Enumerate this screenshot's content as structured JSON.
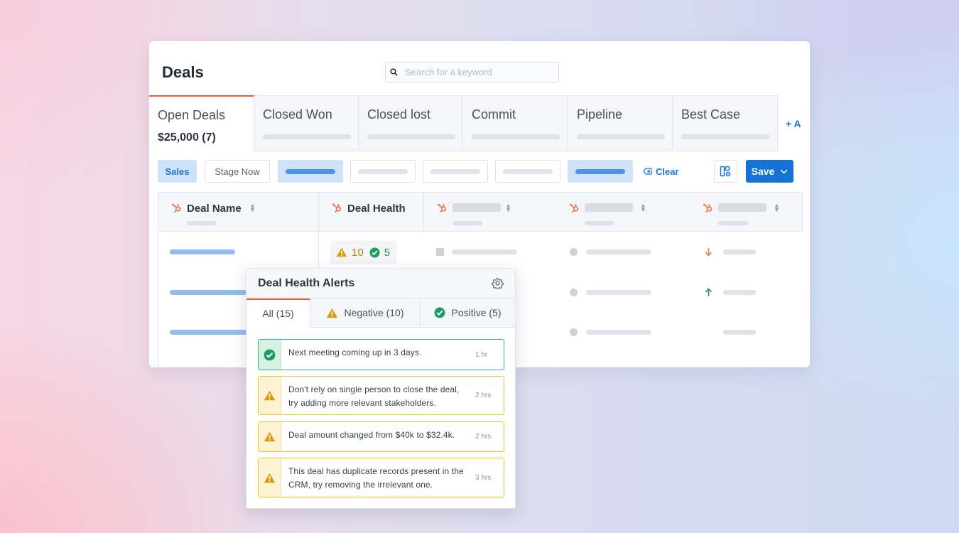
{
  "header": {
    "title": "Deals",
    "search_placeholder": "Search for a keyword"
  },
  "tabs": [
    {
      "label": "Open Deals",
      "value": "$25,000 (7)",
      "active": true
    },
    {
      "label": "Closed Won"
    },
    {
      "label": "Closed lost"
    },
    {
      "label": "Commit"
    },
    {
      "label": "Pipeline"
    },
    {
      "label": "Best Case"
    }
  ],
  "add_tab_label": "+ A",
  "filters": {
    "sales_label": "Sales",
    "stage_label": "Stage Now",
    "clear_label": "Clear",
    "save_label": "Save"
  },
  "table": {
    "columns": [
      "Deal Name",
      "Deal Health"
    ],
    "health": {
      "negative": "10",
      "positive": "5"
    }
  },
  "alerts_popover": {
    "title": "Deal Health Alerts",
    "tabs": [
      {
        "label": "All (15)",
        "icon": "none"
      },
      {
        "label": "Negative (10)",
        "icon": "warning-icon"
      },
      {
        "label": "Positive (5)",
        "icon": "check-circle-icon"
      }
    ],
    "alerts": [
      {
        "type": "positive",
        "text": "Next meeting coming up in 3 days.",
        "time": "1 hr"
      },
      {
        "type": "negative",
        "text": "Don't rely on single person to close the deal, try adding more relevant stakeholders.",
        "time": "2 hrs"
      },
      {
        "type": "negative",
        "text": "Deal amount changed from $40k to $32.4k.",
        "time": "2 hrs"
      },
      {
        "type": "negative",
        "text": "This deal has duplicate records present in the CRM, try removing the irrelevant one.",
        "time": "3 hrs"
      }
    ]
  },
  "colors": {
    "accent": "#1673d6",
    "active_tab": "#f05a3c",
    "hubspot": "#f0734b",
    "warning": "#d99a0b",
    "positive": "#1d9b62"
  }
}
